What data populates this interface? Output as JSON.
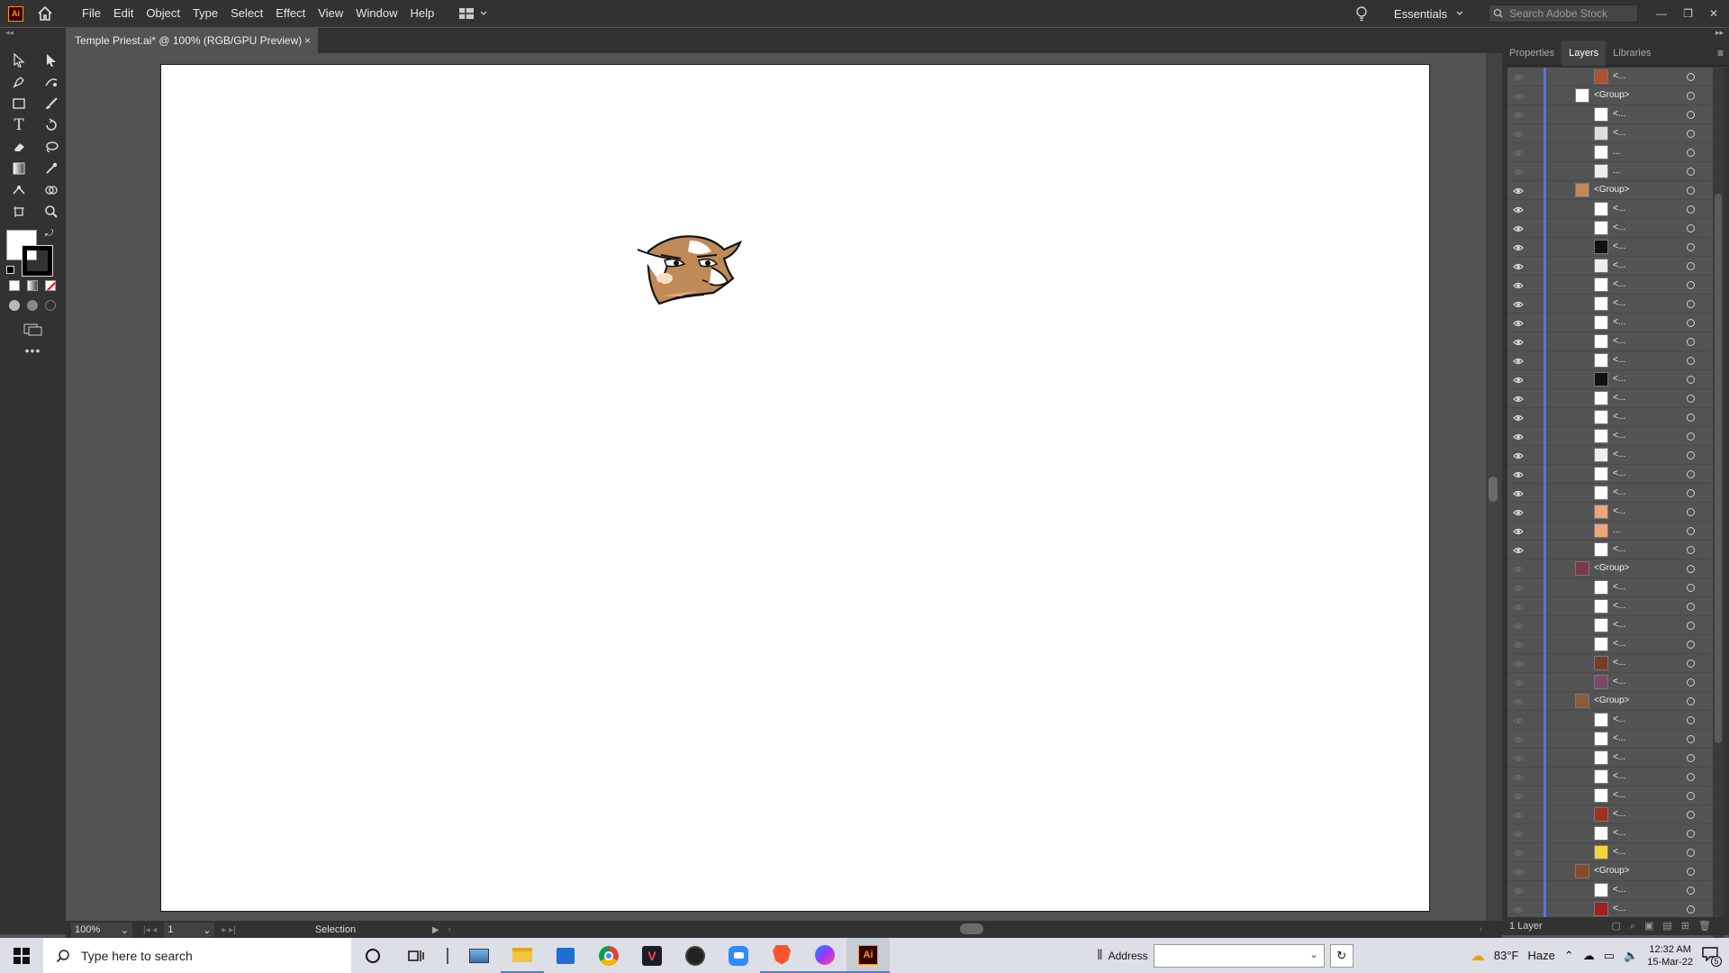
{
  "menubar": {
    "app_logo": "Ai",
    "items": [
      "File",
      "Edit",
      "Object",
      "Type",
      "Select",
      "Effect",
      "View",
      "Window",
      "Help"
    ],
    "workspace": "Essentials",
    "search_placeholder": "Search Adobe Stock"
  },
  "document": {
    "tab_title": "Temple Priest.ai* @ 100% (RGB/GPU Preview)",
    "close_label": "×"
  },
  "status": {
    "zoom": "100%",
    "artboard_number": "1",
    "tool_name": "Selection"
  },
  "panel": {
    "tabs": [
      "Properties",
      "Layers",
      "Libraries"
    ],
    "active_tab": "Layers",
    "layer_count": "1 Layer",
    "group_label": "<Group>",
    "item_label": "<...",
    "ellipsis_label": "..."
  },
  "taskbar": {
    "search_placeholder": "Type here to search",
    "address_label": "Address",
    "weather": "83°F",
    "weather_desc": "Haze",
    "time": "12:32 AM",
    "date": "15-Mar-22",
    "notif_count": "5"
  },
  "colors": {
    "ui_dark": "#323232",
    "ui_mid": "#535353",
    "layer_accent": "#5571ff",
    "ai_orange": "#ff9a00"
  }
}
